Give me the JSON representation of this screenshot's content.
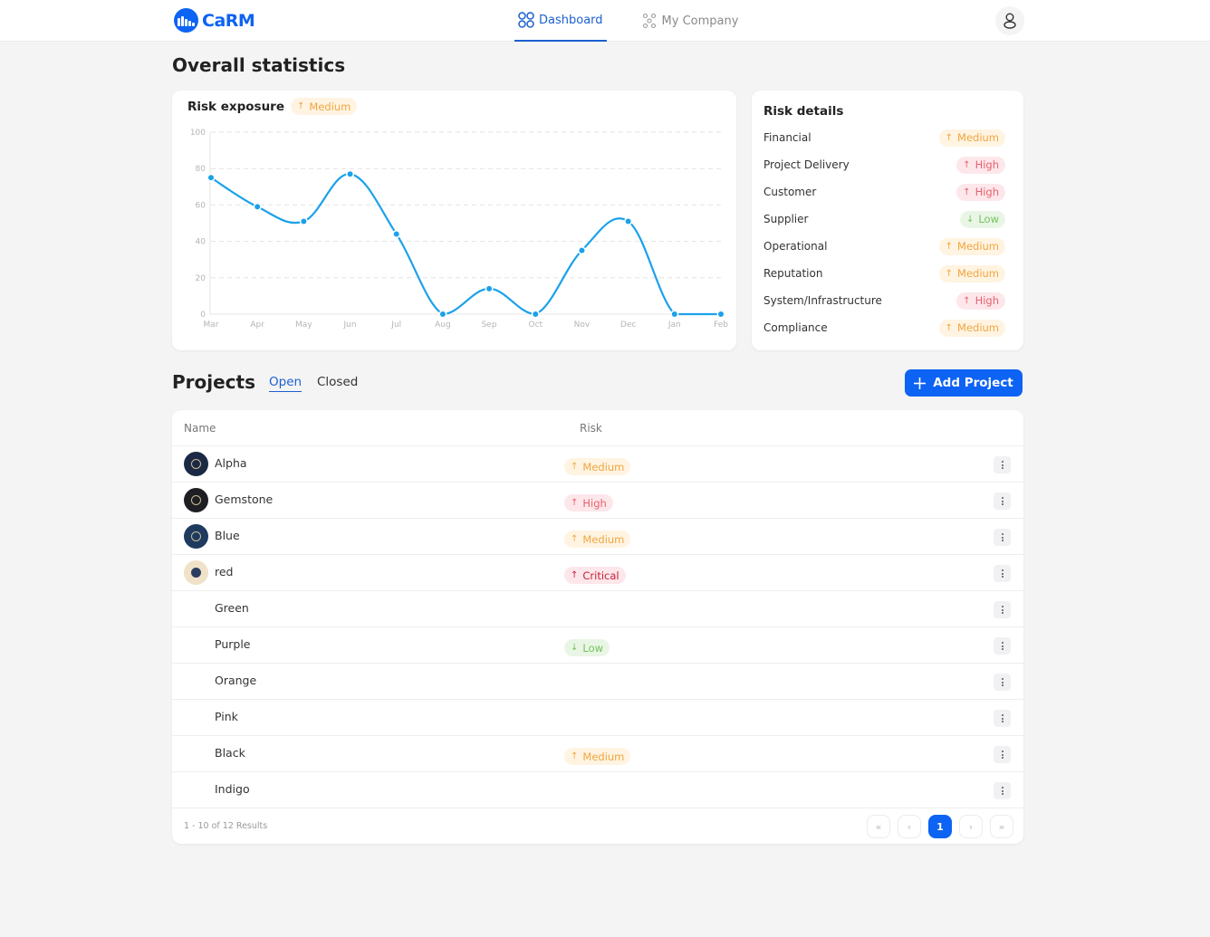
{
  "header": {
    "brand": "CaRM",
    "nav": [
      {
        "label": "Dashboard",
        "icon": "grid-icon",
        "active": true
      },
      {
        "label": "My Company",
        "icon": "org-icon",
        "active": false
      }
    ],
    "user_icon": "user-icon"
  },
  "page_title": "Overall statistics",
  "risk_exposure": {
    "title": "Risk exposure",
    "badge": {
      "label": "Medium",
      "level": "medium",
      "direction": "up"
    }
  },
  "chart_data": {
    "type": "line",
    "title": "Risk exposure",
    "categories": [
      "Mar",
      "Apr",
      "May",
      "Jun",
      "Jul",
      "Aug",
      "Sep",
      "Oct",
      "Nov",
      "Dec",
      "Jan",
      "Feb"
    ],
    "series": [
      {
        "name": "Risk exposure",
        "values": [
          75,
          59,
          51,
          77,
          44,
          0,
          14,
          0,
          35,
          51,
          0,
          0
        ],
        "color": "#1ba1ea"
      }
    ],
    "yticks": [
      0,
      20,
      40,
      60,
      80,
      100
    ],
    "ylim": [
      0,
      100
    ],
    "xlabel": "",
    "ylabel": "",
    "grid": true,
    "legend": "none",
    "smooth": true
  },
  "risk_details": {
    "title": "Risk details",
    "items": [
      {
        "label": "Financial",
        "level": "medium",
        "badge": "Medium",
        "direction": "up"
      },
      {
        "label": "Project Delivery",
        "level": "high",
        "badge": "High",
        "direction": "up"
      },
      {
        "label": "Customer",
        "level": "high",
        "badge": "High",
        "direction": "up"
      },
      {
        "label": "Supplier",
        "level": "low",
        "badge": "Low",
        "direction": "down"
      },
      {
        "label": "Operational",
        "level": "medium",
        "badge": "Medium",
        "direction": "up"
      },
      {
        "label": "Reputation",
        "level": "medium",
        "badge": "Medium",
        "direction": "up"
      },
      {
        "label": "System/Infrastructure",
        "level": "high",
        "badge": "High",
        "direction": "up"
      },
      {
        "label": "Compliance",
        "level": "medium",
        "badge": "Medium",
        "direction": "up"
      }
    ]
  },
  "projects": {
    "title": "Projects",
    "tabs": [
      {
        "label": "Open",
        "active": true
      },
      {
        "label": "Closed",
        "active": false
      }
    ],
    "add_button": "Add Project",
    "columns": {
      "name": "Name",
      "risk": "Risk"
    },
    "rows": [
      {
        "name": "Alpha",
        "avatar": "#1b2a44",
        "risk": "Medium",
        "level": "medium",
        "direction": "up"
      },
      {
        "name": "Gemstone",
        "avatar": "#1e1f22",
        "risk": "High",
        "level": "high",
        "direction": "up"
      },
      {
        "name": "Blue",
        "avatar": "#1e3a5f",
        "risk": "Medium",
        "level": "medium",
        "direction": "up"
      },
      {
        "name": "red",
        "avatar": "#f0e2c8",
        "risk": "Critical",
        "level": "critical",
        "direction": "up"
      },
      {
        "name": "Green",
        "avatar": null,
        "risk": null,
        "level": null,
        "direction": null
      },
      {
        "name": "Purple",
        "avatar": null,
        "risk": "Low",
        "level": "low",
        "direction": "down"
      },
      {
        "name": "Orange",
        "avatar": null,
        "risk": null,
        "level": null,
        "direction": null
      },
      {
        "name": "Pink",
        "avatar": null,
        "risk": null,
        "level": null,
        "direction": null
      },
      {
        "name": "Black",
        "avatar": null,
        "risk": "Medium",
        "level": "medium",
        "direction": "up"
      },
      {
        "name": "Indigo",
        "avatar": null,
        "risk": null,
        "level": null,
        "direction": null
      }
    ],
    "results_text": "1 - 10 of 12 Results",
    "pagination": {
      "first": "«",
      "prev": "‹",
      "current": "1",
      "next": "›",
      "last": "»"
    }
  }
}
